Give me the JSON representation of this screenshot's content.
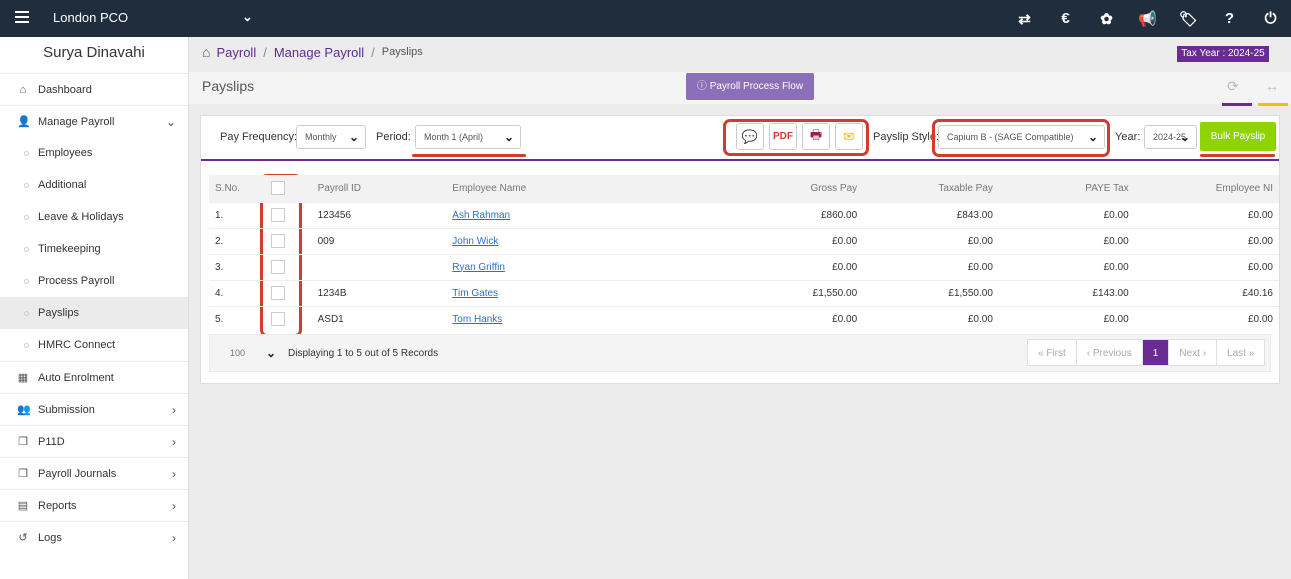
{
  "topbar": {
    "company": "London PCO",
    "icons": [
      "transfer-icon",
      "currency-icon",
      "cubes-icon",
      "announcement-icon",
      "ticket-icon",
      "help-icon",
      "power-icon"
    ],
    "icon_glyphs": [
      "⇄",
      "€",
      "✿",
      "📢",
      "🏷",
      "?",
      "⏻"
    ]
  },
  "sidebar": {
    "user": "Surya Dinavahi",
    "dashboard": "Dashboard",
    "manage_payroll": "Manage Payroll",
    "sub": [
      "Employees",
      "Additional",
      "Leave & Holidays",
      "Timekeeping",
      "Process Payroll",
      "Payslips",
      "HMRC Connect"
    ],
    "active_sub": "Payslips",
    "bottom": [
      "Auto Enrolment",
      "Submission",
      "P11D",
      "Payroll Journals",
      "Reports",
      "Logs"
    ]
  },
  "breadcrumb": {
    "root": "Payroll",
    "sep1": "/",
    "middle": "Manage Payroll",
    "sep2": "/",
    "current": "Payslips"
  },
  "tax_year": "Tax Year : 2024-25",
  "page": {
    "title": "Payslips",
    "flow_button": "Payroll Process Flow"
  },
  "filters": {
    "pay_frequency_label": "Pay Frequency:",
    "pay_frequency_value": "Monthly",
    "period_label": "Period:",
    "period_value": "Month 1 (April)",
    "payslip_style_label": "Payslip Style:",
    "payslip_style_value": "Capium B - (SAGE Compatible)",
    "year_label": "Year:",
    "year_value": "2024-25",
    "bulk_button": "Bulk Payslip"
  },
  "action_icons": [
    "comments-icon",
    "pdf-icon",
    "print-icon",
    "email-icon"
  ],
  "colors": {
    "accent": "#6a2c91",
    "topbar": "#1f2d3d",
    "bulk": "#8fd400",
    "highlight": "#d23b2e",
    "link": "#2a6fc9"
  },
  "table": {
    "headers": [
      "S.No.",
      "",
      "Payroll ID",
      "Employee Name",
      "Gross Pay",
      "Taxable Pay",
      "PAYE Tax",
      "Employee NI"
    ],
    "rows": [
      {
        "sno": "1.",
        "id": "123456",
        "name": "Ash Rahman",
        "gross": "£860.00",
        "taxable": "£843.00",
        "paye": "£0.00",
        "ni": "£0.00"
      },
      {
        "sno": "2.",
        "id": "009",
        "name": "John Wick",
        "gross": "£0.00",
        "taxable": "£0.00",
        "paye": "£0.00",
        "ni": "£0.00"
      },
      {
        "sno": "3.",
        "id": "",
        "name": "Ryan Griffin",
        "gross": "£0.00",
        "taxable": "£0.00",
        "paye": "£0.00",
        "ni": "£0.00"
      },
      {
        "sno": "4.",
        "id": "1234B",
        "name": "Tim Gates",
        "gross": "£1,550.00",
        "taxable": "£1,550.00",
        "paye": "£143.00",
        "ni": "£40.16"
      },
      {
        "sno": "5.",
        "id": "ASD1",
        "name": "Tom Hanks",
        "gross": "£0.00",
        "taxable": "£0.00",
        "paye": "£0.00",
        "ni": "£0.00"
      }
    ]
  },
  "footer": {
    "page_size": "100",
    "display_text": "Displaying 1 to 5 out of 5 Records",
    "pager": {
      "first": "« First",
      "previous": "‹ Previous",
      "current": "1",
      "next": "Next ›",
      "last": "Last »"
    }
  }
}
